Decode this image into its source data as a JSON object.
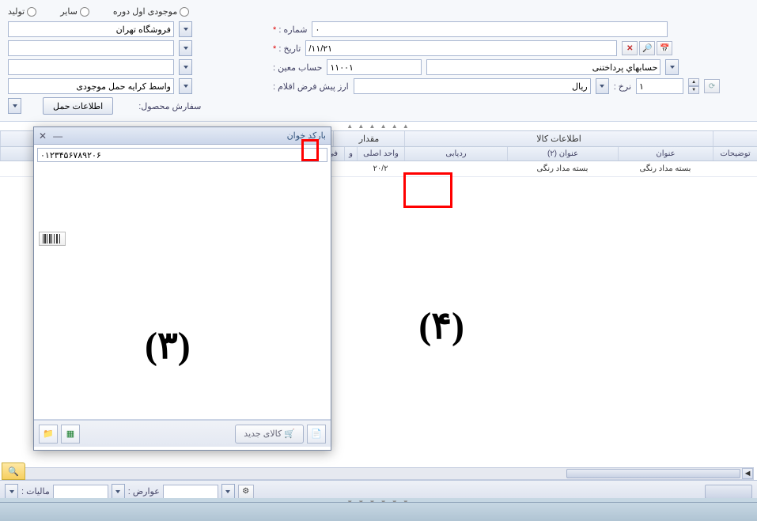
{
  "radios": {
    "prod": "تولید",
    "other": "سایر",
    "opening": "موجودی اول دوره"
  },
  "form": {
    "branch_value": "فروشگاه تهران",
    "number_label": "شماره :",
    "number_value": "٠",
    "date_label": "تاریخ :",
    "date_value": "/١١/٢١",
    "account_label": "حساب معین :",
    "account_code": "١١٠٠١",
    "account_name": "حسابهاي پرداختنی",
    "default_currency_label": "ارز پیش فرض اقلام :",
    "currency_value": "ریال",
    "rate_label": "نرخ :",
    "rate_value": "١",
    "carrier_value": "واسط کرایه حمل موجودی",
    "product_order_label": "سفارش محصول:",
    "cargo_info_btn": "اطلاعات حمل"
  },
  "grid": {
    "group_product": "اطلاعات کالا",
    "group_unit": "مقدار",
    "group_desc": "توضیحات",
    "col_title": "عنوان",
    "col_title2": "عنوان (٢)",
    "col_track": "ردیابی",
    "col_main_unit": "واحد اصلی",
    "col_and": "و",
    "col_fi": "فی",
    "row": {
      "title": "بسته مداد رنگی",
      "title2": "بسته مداد رنگی",
      "main_unit": "٢٠/٢"
    }
  },
  "barcode": {
    "title": "بارکد خوان",
    "input_value": "٠١٢٣۴۵۶٧٨٩٢٠۶",
    "new_item_btn": "کالای جدید"
  },
  "status": {
    "tax_label": "مالیات :",
    "duty_label": "عوارض :"
  },
  "markers": {
    "three": "(۳)",
    "four": "(۴)"
  }
}
